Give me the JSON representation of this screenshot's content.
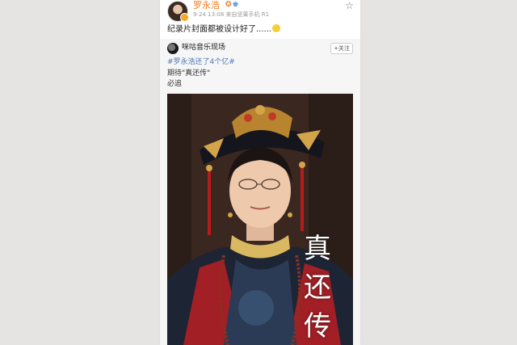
{
  "post": {
    "username": "罗永浩",
    "badge_vip": "✪",
    "badge_other": "♚",
    "meta": "9-24 13:08  来自坚果手机 R1",
    "text": "纪录片封面都被设计好了......",
    "star_icon": "☆"
  },
  "repost": {
    "source_name": "咪咕音乐现场",
    "follow_label": "+关注",
    "hashtag": "#罗永浩还了4个亿#",
    "line2": "期待\"真还传\"",
    "line3": "必追",
    "poster_title": "真还传"
  }
}
